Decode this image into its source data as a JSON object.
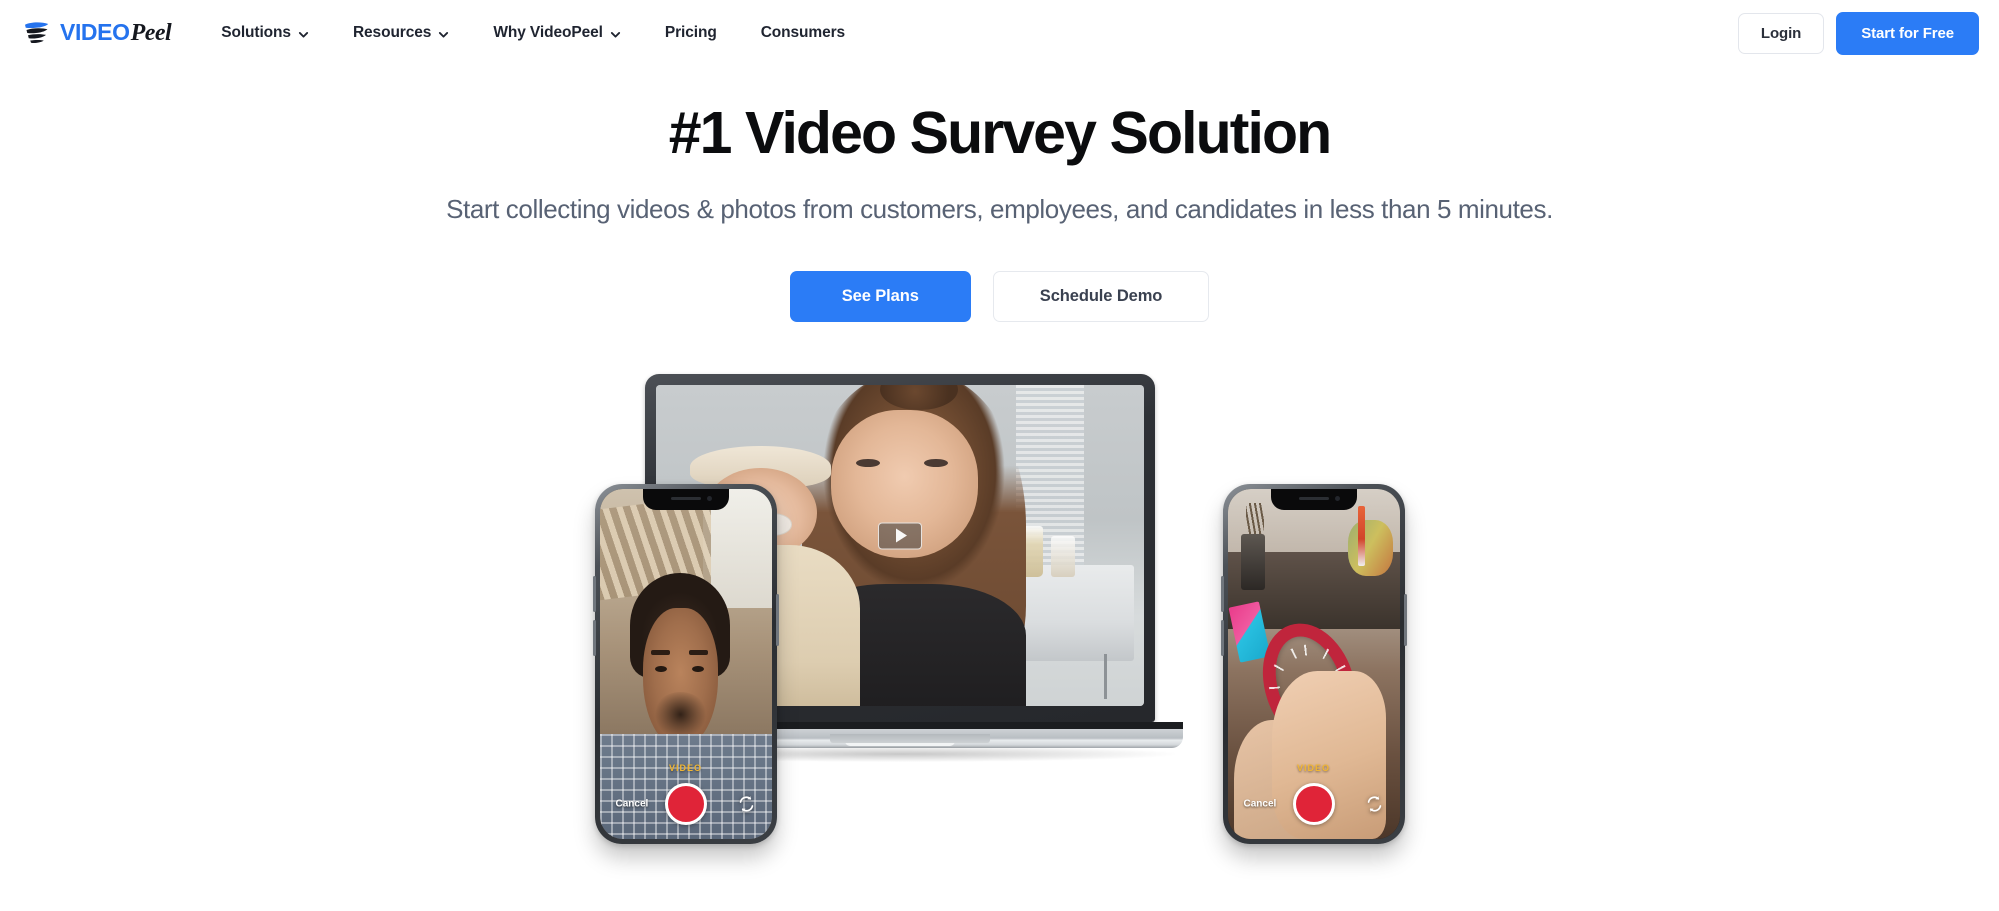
{
  "brand": {
    "logo_icon": "videopeel-wing-logo",
    "name_primary": "VIDEO",
    "name_secondary": "Peel",
    "accent_color": "#2b7cf6"
  },
  "nav": {
    "items": [
      {
        "label": "Solutions",
        "has_dropdown": true,
        "icon": "chevron-down-icon"
      },
      {
        "label": "Resources",
        "has_dropdown": true,
        "icon": "chevron-down-icon"
      },
      {
        "label": "Why VideoPeel",
        "has_dropdown": true,
        "icon": "chevron-down-icon"
      },
      {
        "label": "Pricing",
        "has_dropdown": false,
        "icon": ""
      },
      {
        "label": "Consumers",
        "has_dropdown": false,
        "icon": ""
      }
    ],
    "login_label": "Login",
    "start_free_label": "Start for Free"
  },
  "hero": {
    "title": "#1 Video Survey Solution",
    "subtitle": "Start collecting videos & photos from customers, employees, and candidates in less than 5 minutes.",
    "primary_cta": "See Plans",
    "secondary_cta": "Schedule Demo"
  },
  "devices": {
    "laptop": {
      "play_button_icon": "play-icon",
      "content_description": "woman holding baby video"
    },
    "phone_left": {
      "mode_label": "VIDEO",
      "cancel_label": "Cancel",
      "record_icon": "record-button",
      "flip_icon": "flip-camera-icon"
    },
    "phone_right": {
      "mode_label": "VIDEO",
      "cancel_label": "Cancel",
      "record_icon": "record-button",
      "flip_icon": "flip-camera-icon"
    }
  }
}
